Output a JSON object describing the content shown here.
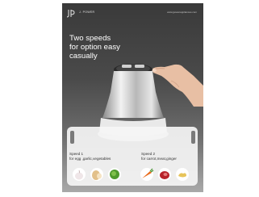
{
  "brand": {
    "name": "J. POWER",
    "logo_icon": "jp-logo-icon"
  },
  "site_url": "www.jpowerappliances.com",
  "headline": [
    "Two speeds",
    "for option easy",
    "casually"
  ],
  "speed1": {
    "title": "Speed 1",
    "desc": "for egg ,garlic,vegetables",
    "foods": [
      "garlic-icon",
      "egg-icon",
      "vegetable-icon"
    ]
  },
  "speed2": {
    "title": "Speed 2",
    "desc": "for carrot,meat,ginger",
    "foods": [
      "carrot-icon",
      "meat-icon",
      "ginger-icon"
    ]
  },
  "colors": {
    "background": "#4a4a4a",
    "panel": "#f5f5f5",
    "text_light": "#ffffff",
    "text_dark": "#333333"
  }
}
